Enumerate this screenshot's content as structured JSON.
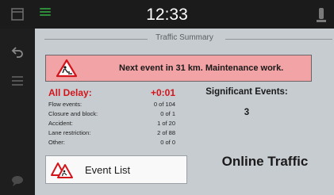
{
  "status_bar": {
    "time": "12:33"
  },
  "page": {
    "title": "Traffic Summary"
  },
  "alert": {
    "text": "Next event in 31 km. Maintenance work."
  },
  "delay": {
    "label": "All Delay:",
    "value": "+0:01"
  },
  "stats": [
    {
      "label": "Flow events:",
      "value": "0 of 104"
    },
    {
      "label": "Closure and block:",
      "value": "0 of 1"
    },
    {
      "label": "Accident:",
      "value": "1 of 20"
    },
    {
      "label": "Lane restriction:",
      "value": "2 of 88"
    },
    {
      "label": "Other:",
      "value": "0 of 0"
    }
  ],
  "significant": {
    "title": "Significant Events:",
    "count": "3"
  },
  "online": {
    "text": "Online Traffic"
  },
  "event_list_button": {
    "label": "Event List"
  },
  "icons": {
    "signal": "signal-bars-icon",
    "gps": "gps-antenna-icon",
    "back": "back-arrow-icon",
    "menu": "menu-icon",
    "alert": "roadworks-warning-icon",
    "event_list": "traffic-events-icon"
  },
  "colors": {
    "alert_bg": "#f2a3a5",
    "delay_text": "#d3151b",
    "panel_bg": "#c7ccd1",
    "signal_green": "#2e8b3a"
  }
}
